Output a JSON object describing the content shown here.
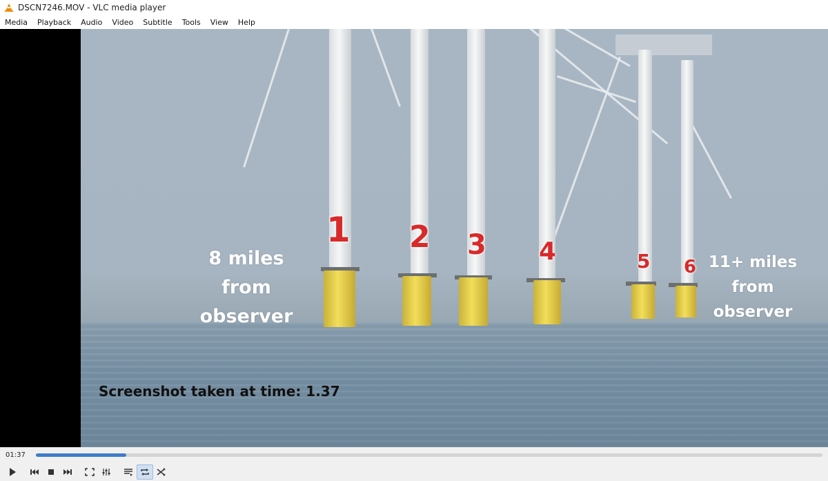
{
  "window": {
    "title": "DSCN7246.MOV - VLC media player"
  },
  "menu": [
    "Media",
    "Playback",
    "Audio",
    "Video",
    "Subtitle",
    "Tools",
    "View",
    "Help"
  ],
  "overlay": {
    "left_caption": [
      "8 miles",
      "from",
      "observer"
    ],
    "right_caption": [
      "11+ miles",
      "from",
      "observer"
    ],
    "numbers": [
      "1",
      "2",
      "3",
      "4",
      "5",
      "6"
    ],
    "screenshot_label": "Screenshot taken at time:  1.37"
  },
  "playback": {
    "elapsed": "01:37",
    "progress_fraction": 0.115
  },
  "controls": [
    "play-icon",
    "previous-icon",
    "stop-icon",
    "next-icon",
    "fullscreen-icon",
    "extended-settings-icon",
    "playlist-icon",
    "loop-icon",
    "random-icon"
  ],
  "colors": {
    "accent": "#3e7cc9",
    "number_red": "#d82a2a"
  }
}
